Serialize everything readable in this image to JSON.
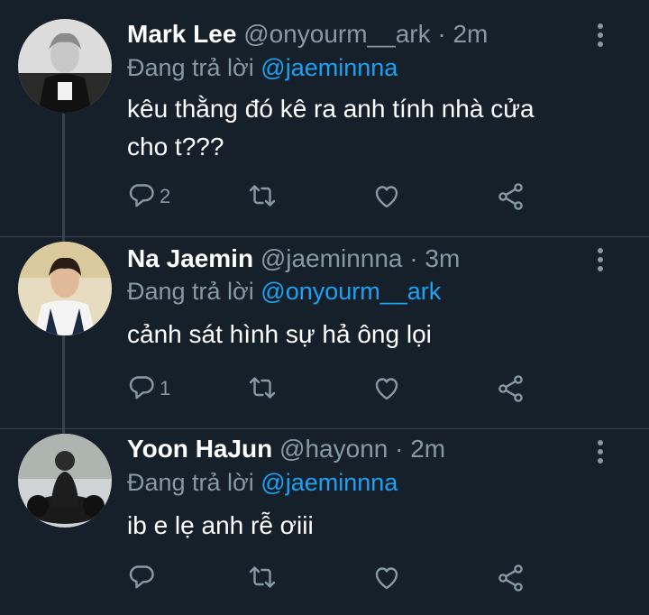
{
  "tweets": [
    {
      "name": "Mark Lee",
      "handle": "@onyourm__ark",
      "sep": "·",
      "time": "2m",
      "reply_prefix": "Đang trả lời",
      "reply_to": "@jaeminnna",
      "text": "kêu thằng đó kê ra anh tính nhà cửa cho t???",
      "reply_count": "2",
      "avatar": "avatar-markl"
    },
    {
      "name": "Na Jaemin",
      "handle": "@jaeminnna",
      "sep": "·",
      "time": "3m",
      "reply_prefix": "Đang trả lời",
      "reply_to": "@onyourm__ark",
      "text": "cảnh sát hình sự hả ông lọi",
      "reply_count": "1",
      "avatar": "avatar-jaemin"
    },
    {
      "name": "Yoon HaJun",
      "handle": "@hayonn",
      "sep": "·",
      "time": "2m",
      "reply_prefix": "Đang trả lời",
      "reply_to": "@jaeminnna",
      "text": "ib e lẹ anh rễ ơiii",
      "reply_count": "",
      "avatar": "avatar-hajun"
    }
  ],
  "icons": {
    "reply": "reply-icon",
    "retweet": "retweet-icon",
    "like": "heart-icon",
    "share": "share-icon",
    "more": "more-vertical-icon"
  },
  "colors": {
    "background": "#15202b",
    "secondary_text": "#8899a6",
    "accent": "#1da1f2",
    "divider": "#38444d"
  }
}
